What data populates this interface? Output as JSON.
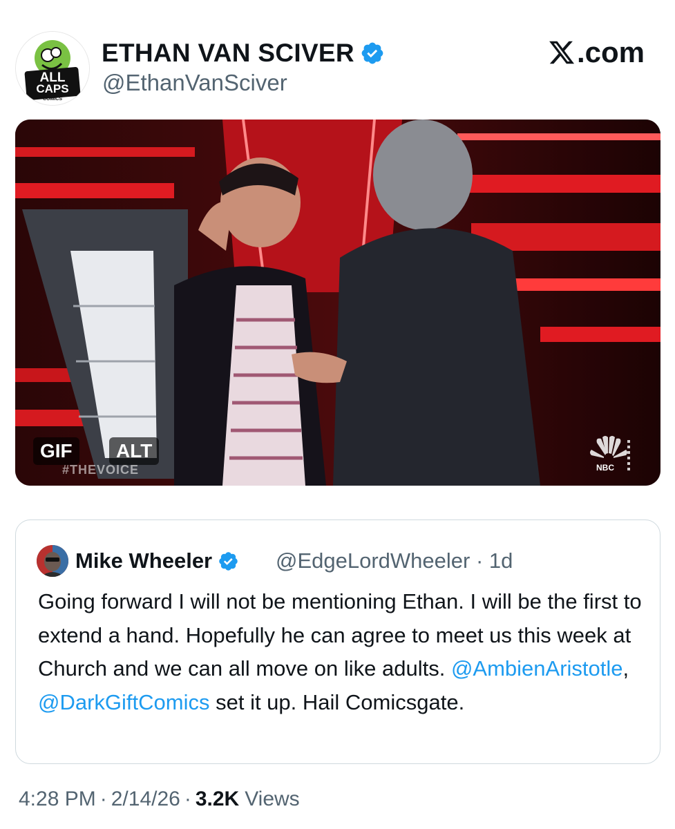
{
  "tweet": {
    "author": {
      "name": "ETHAN VAN SCIVER",
      "handle": "@EthanVanSciver",
      "verified": true,
      "avatar_logo_text": [
        "ALL",
        "CAPS",
        "COMICS"
      ]
    },
    "site_label": ".com",
    "media": {
      "gif_badge": "GIF",
      "alt_badge": "ALT",
      "overlay_tag": "#THEVOICE",
      "network_logo": "NBC"
    },
    "quoted": {
      "name": "Mike Wheeler",
      "verified": true,
      "handle_and_time": "@EdgeLordWheeler · 1d",
      "text_part1": "Going forward I will not be mentioning Ethan. I will be the first to extend a hand. Hopefully he can agree to meet us this week at Church and we can all move on like adults. ",
      "mention1": "@AmbienAristotle",
      "text_part2": ", ",
      "mention2": "@DarkGiftComics",
      "text_part3": " set it up. Hail Comicsgate."
    },
    "meta": {
      "time": "4:28 PM",
      "date": "2/14/26",
      "views_count": "3.2K",
      "views_label": "Views",
      "separator": "·"
    }
  },
  "colors": {
    "text_primary": "#0f1419",
    "text_secondary": "#536471",
    "link": "#1d9bf0",
    "verified_badge": "#1d9bf0",
    "border": "#cfd9de"
  },
  "icons": {
    "verified": "verified-badge-icon",
    "x_logo": "x-logo-icon"
  }
}
